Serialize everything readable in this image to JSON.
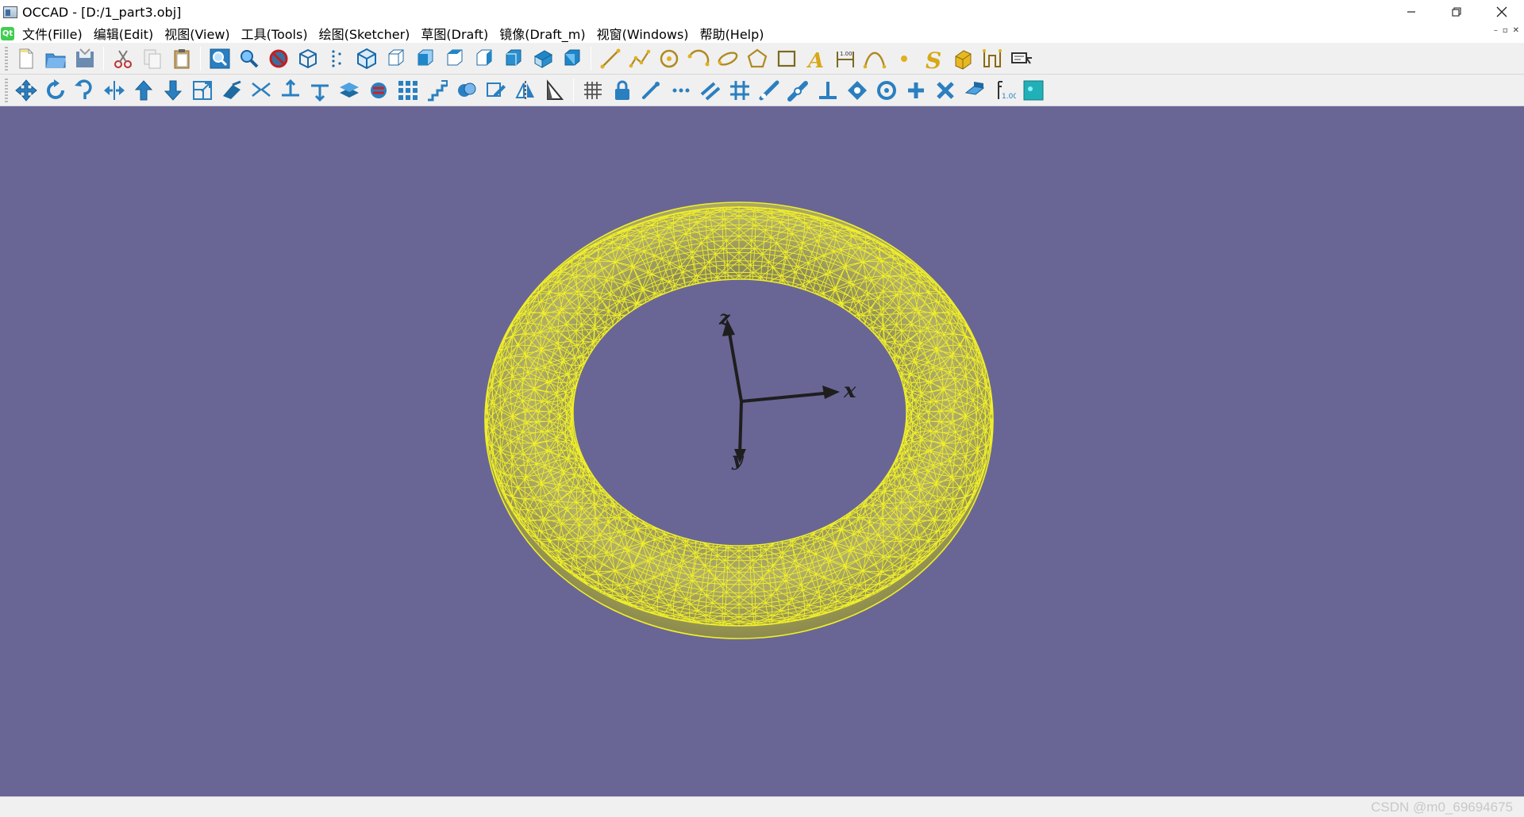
{
  "window": {
    "title": "OCCAD - [D:/1_part3.obj]"
  },
  "menu": [
    "文件(Fille)",
    "编辑(Edit)",
    "视图(View)",
    "工具(Tools)",
    "绘图(Sketcher)",
    "草图(Draft)",
    "镜像(Draft_m)",
    "视窗(Windows)",
    "帮助(Help)"
  ],
  "toolbar1": {
    "file": [
      "new-file",
      "open-file",
      "save-file"
    ],
    "edit": [
      "cut",
      "copy",
      "paste"
    ],
    "view": [
      "zoom-window",
      "zoom-fit",
      "hide",
      "wireframe",
      "points",
      "iso",
      "view-front",
      "view-top",
      "view-left",
      "view-right",
      "view-axo",
      "view-bottom",
      "view-back"
    ],
    "sketch": [
      "line",
      "polyline",
      "circle",
      "arc",
      "ellipse",
      "polygon",
      "rectangle",
      "text",
      "dimension",
      "bspline",
      "point",
      "spline-s",
      "extrude",
      "offset",
      "label"
    ]
  },
  "toolbar2": {
    "modify": [
      "move",
      "rotate",
      "rotate-cw",
      "mirror-h",
      "arrow-up",
      "arrow-down",
      "scale",
      "extend",
      "trim",
      "split-up",
      "split-down",
      "upgrade",
      "downgrade",
      "array",
      "stairs",
      "clone",
      "edit-shape",
      "mirror",
      "triangle"
    ],
    "snap": [
      "grid",
      "lock",
      "endpoint",
      "midpoint",
      "parallel",
      "grid-snap",
      "extension",
      "near",
      "perpendicular",
      "special",
      "center",
      "plus",
      "intersection",
      "working-plane",
      "dimension-snap",
      "cyan-box"
    ]
  },
  "scene": {
    "axis_labels": {
      "x": "x",
      "y": "y",
      "z": "z"
    },
    "mesh_color": "#f0ef2a",
    "fill_color": "#aaa860",
    "background": "#696696"
  },
  "status": {
    "watermark": "CSDN @m0_69694675"
  }
}
